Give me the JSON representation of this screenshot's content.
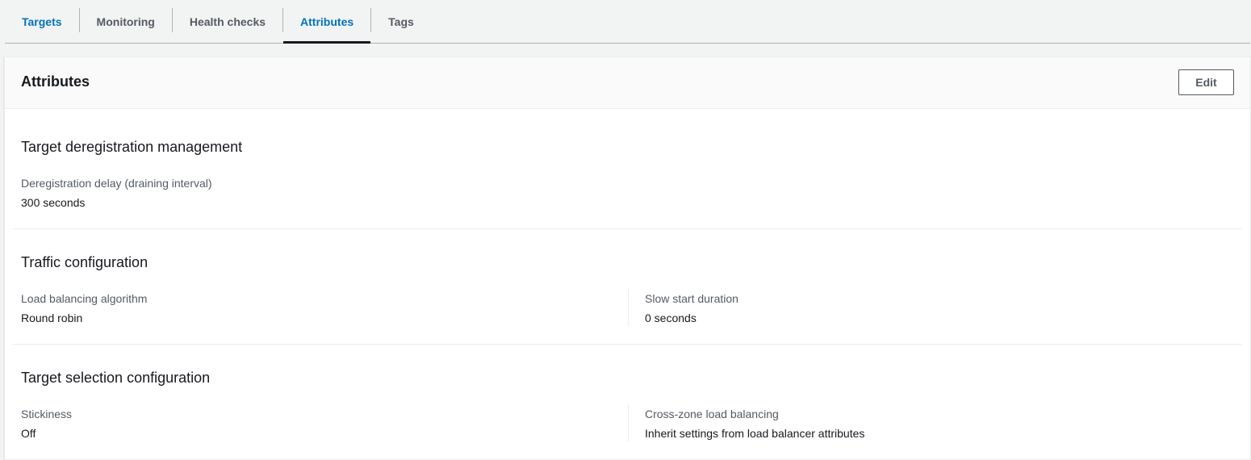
{
  "tabs": [
    {
      "label": "Targets"
    },
    {
      "label": "Monitoring"
    },
    {
      "label": "Health checks"
    },
    {
      "label": "Attributes"
    },
    {
      "label": "Tags"
    }
  ],
  "active_tab": "Attributes",
  "panel": {
    "title": "Attributes",
    "edit_label": "Edit"
  },
  "sections": {
    "deregistration": {
      "title": "Target deregistration management",
      "delay_label": "Deregistration delay (draining interval)",
      "delay_value": "300 seconds"
    },
    "traffic": {
      "title": "Traffic configuration",
      "algorithm_label": "Load balancing algorithm",
      "algorithm_value": "Round robin",
      "slow_start_label": "Slow start duration",
      "slow_start_value": "0 seconds"
    },
    "target_selection": {
      "title": "Target selection configuration",
      "stickiness_label": "Stickiness",
      "stickiness_value": "Off",
      "cross_zone_label": "Cross-zone load balancing",
      "cross_zone_value": "Inherit settings from load balancer attributes"
    }
  }
}
